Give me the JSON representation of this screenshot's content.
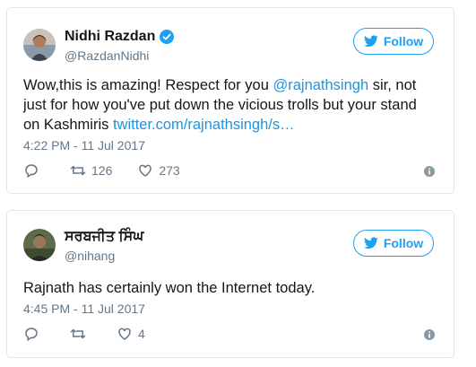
{
  "tweets": [
    {
      "name": "Nidhi Razdan",
      "handle": "@RazdanNidhi",
      "follow_label": "Follow",
      "text_before": "Wow,this is amazing! Respect for you ",
      "mention": "@rajnathsingh",
      "text_after": " sir, not just for how you've put down the vicious trolls but your stand on Kashmiris ",
      "link": "twitter.com/rajnathsingh/s…",
      "timestamp": "4:22 PM - 11 Jul 2017",
      "retweets": "126",
      "likes": "273",
      "verified": true
    },
    {
      "name": "ਸਰਬਜੀਤ ਸਿੰਘ",
      "handle": "@nihang",
      "follow_label": "Follow",
      "text": "Rajnath has certainly won the Internet today.",
      "timestamp": "4:45 PM - 11 Jul 2017",
      "retweets": "",
      "likes": "4",
      "verified": false
    }
  ],
  "colors": {
    "accent": "#1da1f2",
    "link": "#1b95e0",
    "muted": "#657786",
    "border": "#e1e8ed"
  },
  "icons": [
    "verified-badge-icon",
    "twitter-bird-icon",
    "reply-icon",
    "retweet-icon",
    "like-heart-icon",
    "info-icon"
  ]
}
